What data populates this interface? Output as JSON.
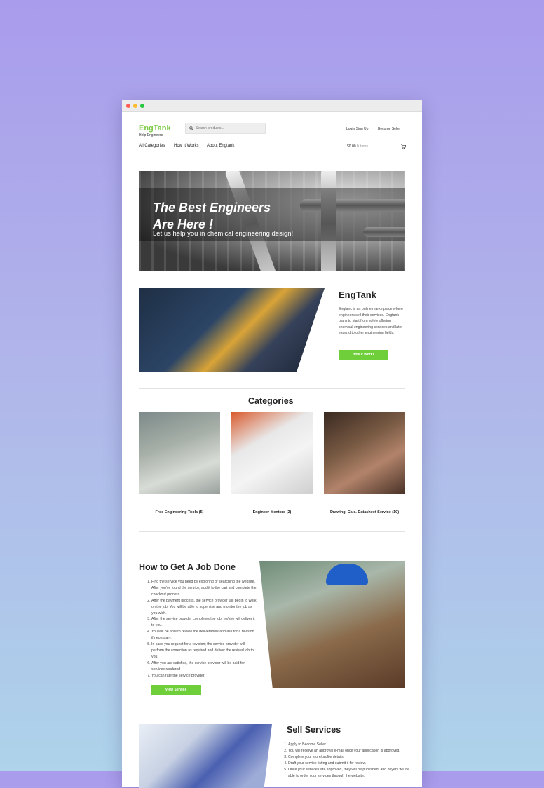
{
  "window": {
    "dots": [
      "#ff5f57",
      "#febc2e",
      "#28c840"
    ]
  },
  "header": {
    "brand": "EngTank",
    "tagline": "Help Engineers",
    "search_placeholder": "Search products...",
    "login_label": "Login Sign Up",
    "become_seller_label": "Become Seller"
  },
  "nav": {
    "items": [
      "All Categories",
      "How It Works",
      "About Engtank"
    ],
    "cart_amount": "$0.00",
    "cart_items": "0 items"
  },
  "hero": {
    "title_line1": "The Best Engineers",
    "title_line2": "Are Here !",
    "subtitle": "Let us help you in chemical engineering design!"
  },
  "about": {
    "title": "EngTank",
    "text": "Engtanc is an online marketplace where engineers sell their services. Engtank plans to start from solely offering chemical engineering services and later expand to other engineering fields.",
    "button_label": "How It Works"
  },
  "categories": {
    "title": "Categories",
    "items": [
      "Free Engineering Tools (5)",
      "Engineer Mentors (2)",
      "Drawing, Calc. Datasheet Service (10)"
    ]
  },
  "howto": {
    "title": "How to Get A Job Done",
    "steps": [
      "Find the service you need by exploring or searching the website. After you've found the service, add it to the cart and complete the checkout process.",
      "After the payment process, the service provider will begin to work on the job. You will be able to supervise and monitor the job as you wish.",
      "After the service provider completes the job, he/she will deliver it to you.",
      "You will be able to review the deliverables and ask for a revision if necessary.",
      "In case you request for a revision; the service provider will perform the correction as required and deliver the revised job to you.",
      "After you are satisfied, the service provider will be paid for services rendered.",
      "You can rate the service provider."
    ],
    "button_label": "View Service"
  },
  "sell": {
    "title": "Sell Services",
    "steps": [
      "Apply to Become Seller.",
      "You will receive an approval e-mail once your application is approved.",
      "Complete your store/profile details.",
      "Draft your service listing and submit it for review.",
      "Once your services are approved, they will be published, and buyers will be able to order your services through the website."
    ]
  },
  "colors": {
    "accent": "#6fcf3b",
    "brand": "#7ac943"
  }
}
